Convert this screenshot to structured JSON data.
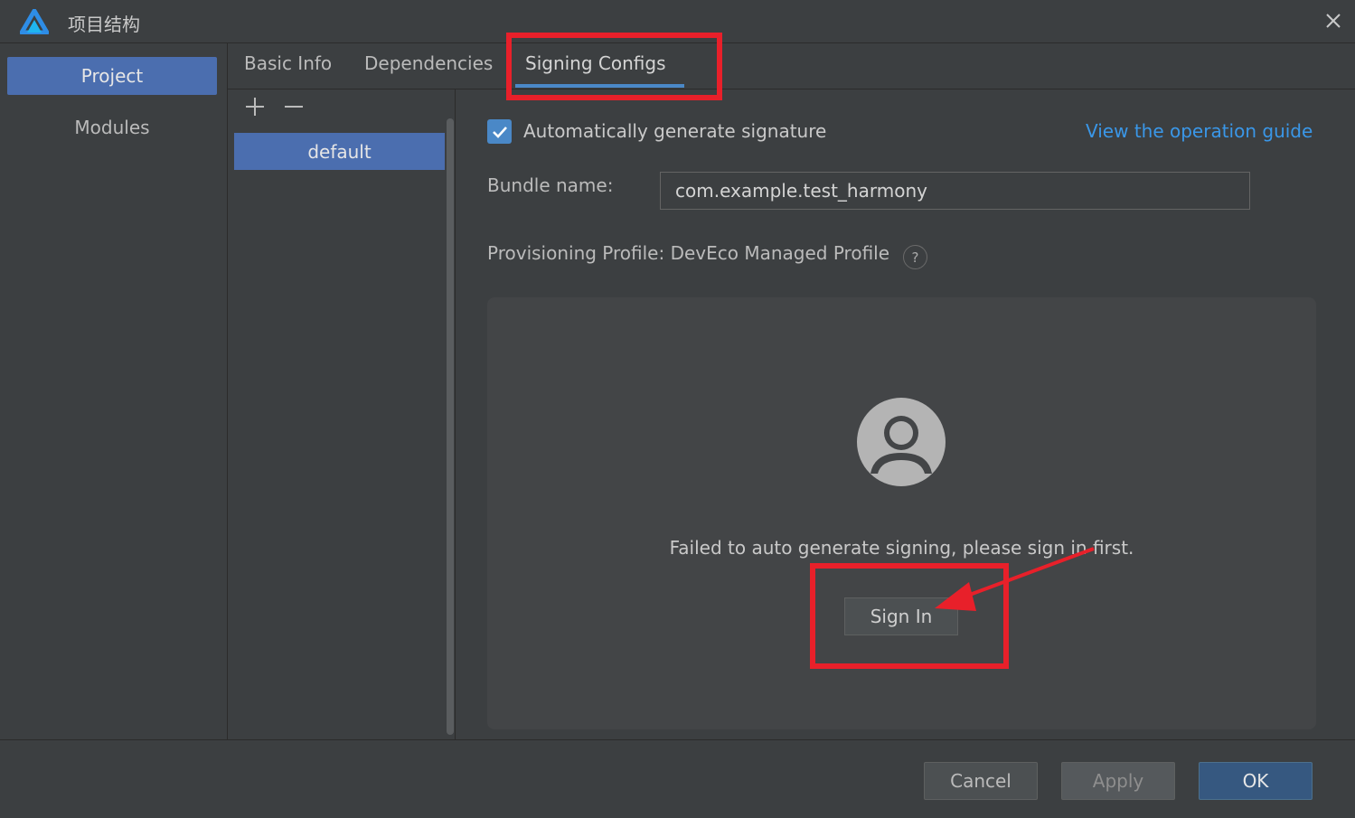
{
  "window": {
    "title": "项目结构",
    "logo_icon": "deveco-logo-icon",
    "close_icon": "close-icon"
  },
  "sidebar": {
    "items": [
      {
        "label": "Project",
        "active": true
      },
      {
        "label": "Modules",
        "active": false
      }
    ]
  },
  "tabs": [
    {
      "label": "Basic Info",
      "active": false
    },
    {
      "label": "Dependencies",
      "active": false
    },
    {
      "label": "Signing Configs",
      "active": true
    }
  ],
  "config_list": {
    "add_icon": "plus-icon",
    "remove_icon": "minus-icon",
    "items": [
      {
        "label": "default",
        "selected": true
      }
    ]
  },
  "signing": {
    "auto_generate": {
      "label": "Automatically generate signature",
      "checked": true
    },
    "guide_link": "View the operation guide",
    "bundle_name_label": "Bundle name:",
    "bundle_name_value": "com.example.test_harmony",
    "profile_label": "Provisioning Profile: DevEco Managed Profile",
    "help_glyph": "?",
    "avatar_icon": "user-avatar-icon",
    "fail_message": "Failed to auto generate signing, please sign in first.",
    "sign_in_label": "Sign In"
  },
  "footer": {
    "cancel_label": "Cancel",
    "apply_label": "Apply",
    "ok_label": "OK"
  },
  "colors": {
    "accent": "#4b6eaf",
    "link": "#3a97e8",
    "annotation": "#e8202a"
  }
}
